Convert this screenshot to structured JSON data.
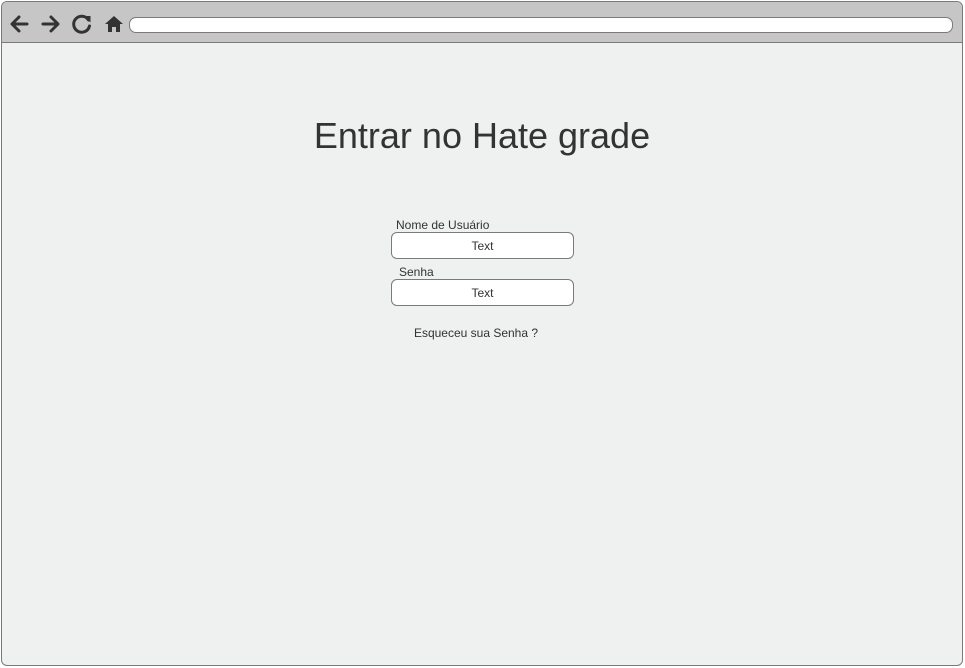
{
  "browser": {
    "toolbar": {
      "back_icon": "arrow-left-icon",
      "forward_icon": "arrow-right-icon",
      "reload_icon": "reload-icon",
      "home_icon": "home-icon"
    },
    "address_bar": {
      "value": ""
    }
  },
  "login": {
    "title": "Entrar no Hate grade",
    "username": {
      "label": "Nome de Usuário",
      "value": "Text"
    },
    "password": {
      "label": "Senha",
      "value": "Text"
    },
    "forgot_link": "Esqueceu sua Senha ?"
  },
  "colors": {
    "page_background": "#eff0f0",
    "toolbar_background": "#c6c6c6",
    "border": "#7a7a7a",
    "text": "#333333"
  }
}
